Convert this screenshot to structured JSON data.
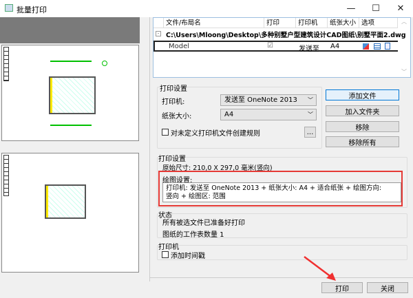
{
  "window": {
    "title": "批量打印",
    "minimize": "—",
    "maximize": "☐",
    "close": "✕"
  },
  "table": {
    "headers": [
      "文件/布局名",
      "打印",
      "打印机",
      "纸张大小",
      "选项"
    ],
    "file_row": "C:\\Users\\Mloong\\Desktop\\多种别墅户型建筑设计CAD图纸\\别墅平面2.dwg",
    "layout_row": {
      "name": "Model",
      "print_checked": "☑",
      "printer": "发送至",
      "paper": "A4"
    }
  },
  "print_settings": {
    "title": "打印设置",
    "printer_label": "打印机:",
    "printer_value": "发送至 OneNote 2013",
    "paper_label": "纸张大小:",
    "paper_value": "A4",
    "rule_checkbox": "对未定义打印机文件创建规则",
    "ellipsis": "..."
  },
  "side_buttons": {
    "add_file": "添加文件",
    "add_folder": "加入文件夹",
    "remove": "移除",
    "remove_all": "移除所有"
  },
  "plot_settings": {
    "title": "打印设置",
    "original_size": "原始尺寸: 210,0 X 297,0 毫米(竖向)",
    "drawing_label": "绘图设置:",
    "drawing_text": "打印机: 发送至 OneNote 2013 + 纸张大小: A4 + 适合纸张 + 绘图方向: 竖向 + 绘图区: 范围"
  },
  "status": {
    "title": "状态",
    "line1": "所有被选文件已准备好打印",
    "line2": "图纸的工作表数量 1"
  },
  "printer": {
    "title": "打印机",
    "timestamp": "添加时间戳"
  },
  "footer": {
    "print": "打印",
    "close": "关闭"
  },
  "colors": {
    "highlight": "#e53935",
    "accent": "#0078d7"
  }
}
